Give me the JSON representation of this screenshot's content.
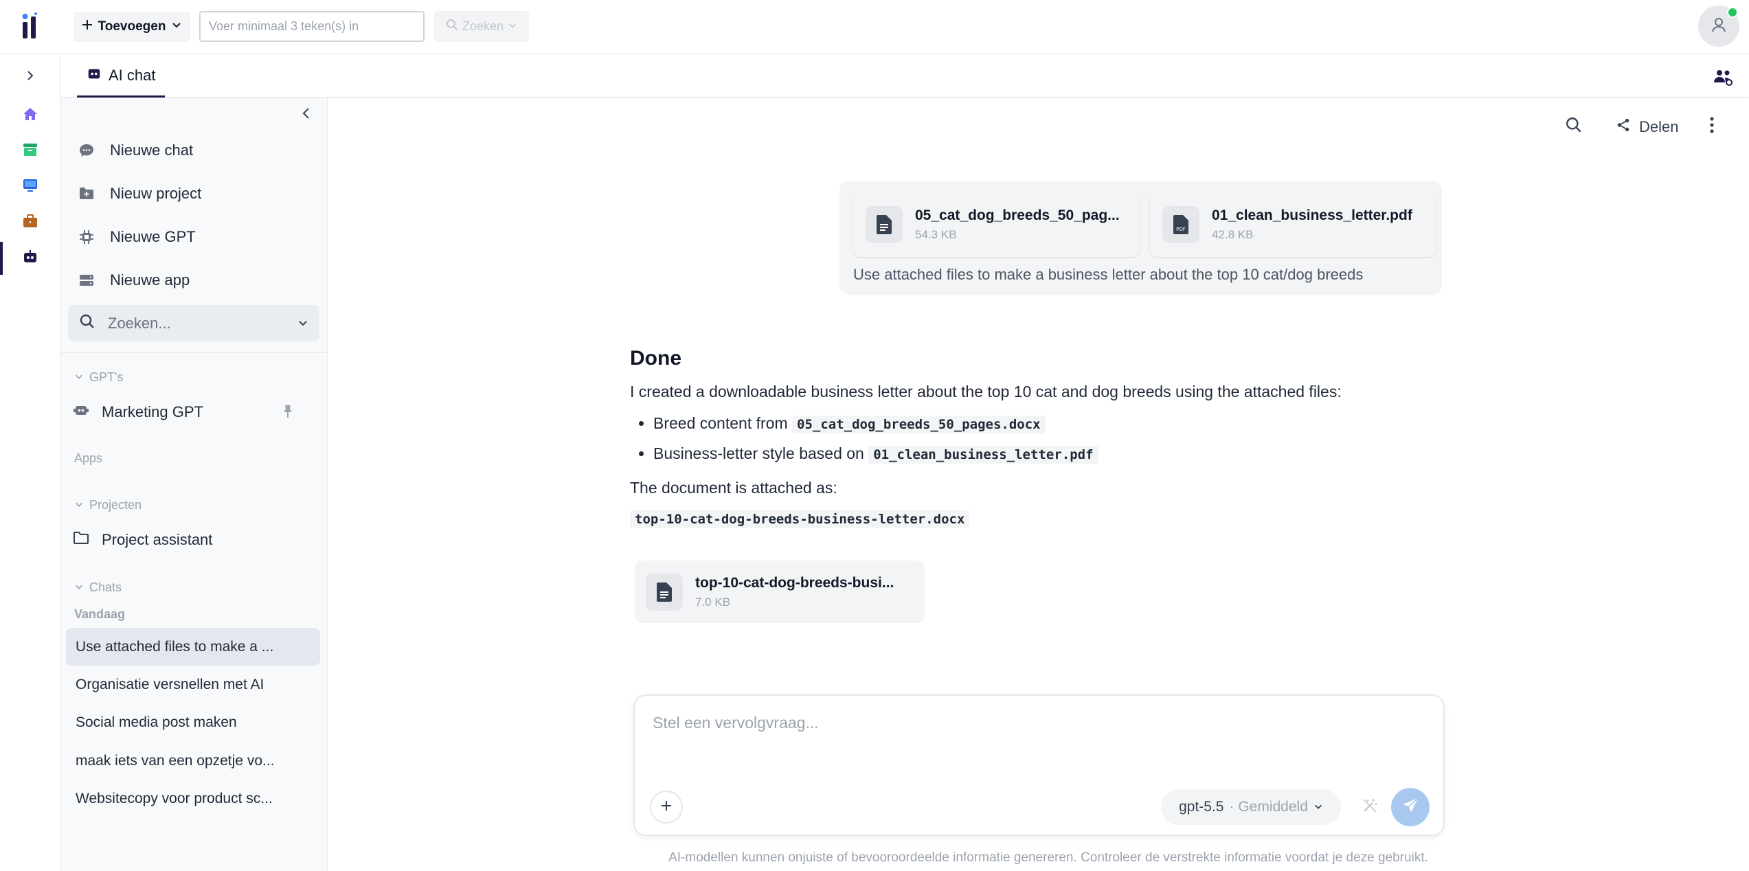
{
  "topbar": {
    "add_label": "Toevoegen",
    "search_placeholder": "Voer minimaal 3 teken(s) in",
    "search_button": "Zoeken"
  },
  "tabs": [
    {
      "label": "AI chat"
    }
  ],
  "sidebar": {
    "actions": [
      {
        "label": "Nieuwe chat",
        "icon": "chat-bubble-icon"
      },
      {
        "label": "Nieuw project",
        "icon": "folder-plus-icon"
      },
      {
        "label": "Nieuwe GPT",
        "icon": "chip-icon"
      },
      {
        "label": "Nieuwe app",
        "icon": "server-icon"
      }
    ],
    "search_placeholder": "Zoeken...",
    "sections": {
      "gpts": "GPT's",
      "apps": "Apps",
      "projects": "Projecten",
      "chats": "Chats"
    },
    "gpt_items": [
      {
        "label": "Marketing GPT"
      }
    ],
    "project_items": [
      {
        "label": "Project assistant"
      }
    ],
    "today_label": "Vandaag",
    "chat_items": [
      {
        "label": "Use attached files to make a ..."
      },
      {
        "label": "Organisatie versnellen met AI"
      },
      {
        "label": "Social media post maken"
      },
      {
        "label": "maak iets van een opzetje vo..."
      },
      {
        "label": "Websitecopy voor product sc..."
      }
    ]
  },
  "toolbar": {
    "share_label": "Delen"
  },
  "conversation": {
    "user_message": {
      "attachments": [
        {
          "name": "05_cat_dog_breeds_50_pag...",
          "size": "54.3 KB",
          "type": "docx"
        },
        {
          "name": "01_clean_business_letter.pdf",
          "size": "42.8 KB",
          "type": "pdf"
        }
      ],
      "text": "Use attached files to make a business letter about the top 10 cat/dog breeds"
    },
    "assistant": {
      "heading": "Done",
      "intro": "I created a downloadable business letter about the top 10 cat and dog breeds using the attached files:",
      "bullets": [
        {
          "text": "Breed content from ",
          "code": "05_cat_dog_breeds_50_pages.docx"
        },
        {
          "text": "Business-letter style based on ",
          "code": "01_clean_business_letter.pdf"
        }
      ],
      "attached_as": "The document is attached as:",
      "output_code": "top-10-cat-dog-breeds-business-letter.docx",
      "output_file": {
        "name": "top-10-cat-dog-breeds-busi...",
        "size": "7.0 KB"
      }
    }
  },
  "composer": {
    "placeholder": "Stel een vervolgvraag...",
    "model": "gpt-5.5",
    "model_mode": "· Gemiddeld"
  },
  "disclaimer": "AI-modellen kunnen onjuiste of bevooroordeelde informatie genereren. Controleer de verstrekte informatie voordat je deze gebruikt.",
  "colors": {
    "brand": "#1e1b4b",
    "status_online": "#22c55e",
    "send_button": "#a9c8f0"
  }
}
